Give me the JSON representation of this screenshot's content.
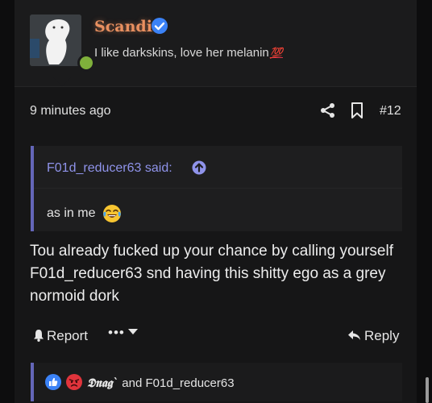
{
  "post": {
    "author": {
      "name": "Scandi.",
      "verified": true,
      "title": "I like darkskins, love her melanin",
      "title_emoji": "💯",
      "online": true
    },
    "timestamp": "9 minutes ago",
    "post_number": "#12",
    "quote": {
      "author_label": "F01d_reducer63 said:",
      "body": "as in me",
      "body_emoji": "joy-emoji"
    },
    "message": "Tou already fucked up your chance by calling yourself F01d_reducer63 snd having this shitty ego as a grey normoid dork",
    "actions": {
      "report_label": "Report",
      "more_label": "•••",
      "reply_label": "Reply"
    },
    "reactions": {
      "icons": [
        "like-icon",
        "angry-icon"
      ],
      "user1": "𝕯𝖓𝖆𝖌`",
      "joiner": " and ",
      "user2": "F01d_reducer63"
    }
  },
  "colors": {
    "accent": "#6466b8",
    "username": "#e99060",
    "online": "#7fb03b",
    "verified": "#3b82f6",
    "link": "#8f93ea"
  }
}
